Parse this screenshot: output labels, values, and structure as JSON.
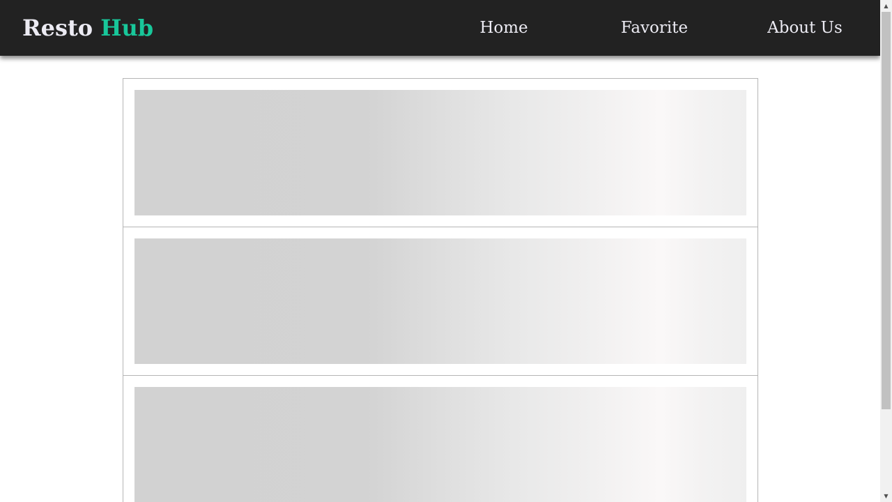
{
  "header": {
    "brand": {
      "part1": "Resto",
      "part2": "Hub"
    },
    "nav": [
      {
        "label": "Home"
      },
      {
        "label": "Favorite"
      },
      {
        "label": "About Us"
      }
    ]
  },
  "main": {
    "skeleton_cards": [
      {
        "state": "loading"
      },
      {
        "state": "loading"
      },
      {
        "state": "loading"
      }
    ]
  },
  "colors": {
    "navbar_bg": "#222222",
    "brand_text": "#ecebf3",
    "brand_accent": "#18c79a",
    "skeleton_base": "#d2d2d2",
    "skeleton_highlight": "#faf8f8"
  },
  "scrollbar": {
    "up_icon": "chevron-up-icon",
    "down_icon": "chevron-down-icon"
  }
}
